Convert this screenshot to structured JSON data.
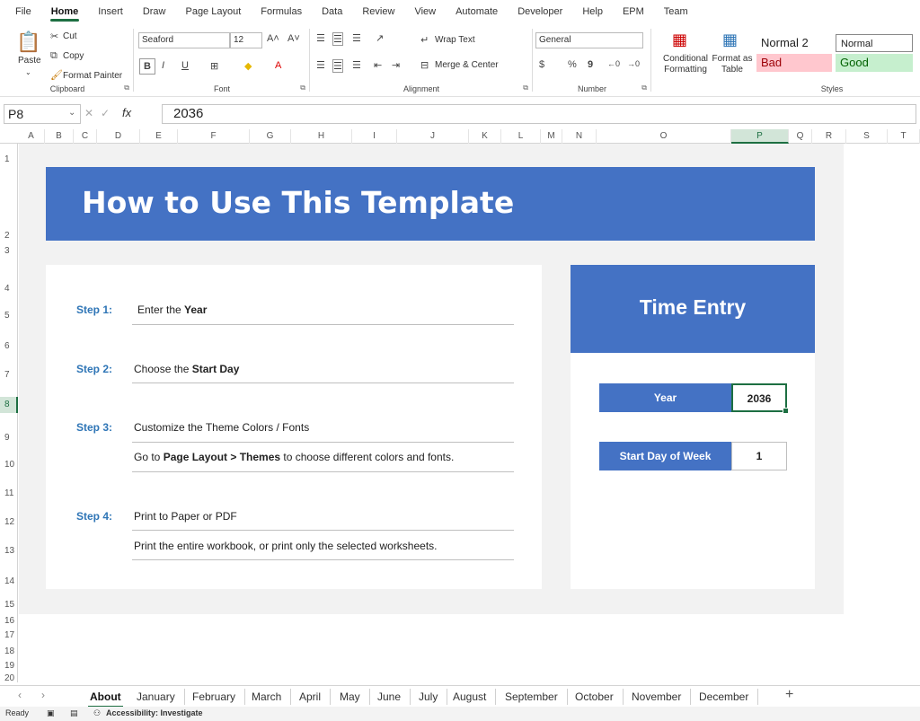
{
  "menu": [
    "File",
    "Home",
    "Insert",
    "Draw",
    "Page Layout",
    "Formulas",
    "Data",
    "Review",
    "View",
    "Automate",
    "Developer",
    "Help",
    "EPM",
    "Team"
  ],
  "ribbon": {
    "clipboard": {
      "paste": "Paste",
      "cut": "Cut",
      "copy": "Copy",
      "format_painter": "Format Painter",
      "label": "Clipboard"
    },
    "font": {
      "name": "Seaford",
      "size": "12",
      "label": "Font",
      "bold": "B",
      "italic": "I",
      "underline": "U"
    },
    "alignment": {
      "wrap": "Wrap Text",
      "merge": "Merge & Center",
      "label": "Alignment"
    },
    "number": {
      "format": "General",
      "label": "Number",
      "currency": "$",
      "percent": "%",
      "comma": "9"
    },
    "styles": {
      "cond_format": "Conditional Formatting",
      "format_table": "Format as Table",
      "normal2": "Normal 2",
      "normal": "Normal",
      "bad": "Bad",
      "good": "Good",
      "label": "Styles"
    }
  },
  "formula_bar": {
    "cell_ref": "P8",
    "fx": "fx",
    "value": "2036"
  },
  "columns": [
    "A",
    "B",
    "C",
    "D",
    "E",
    "F",
    "G",
    "H",
    "I",
    "J",
    "K",
    "L",
    "M",
    "N",
    "O",
    "P",
    "Q",
    "R",
    "S",
    "T"
  ],
  "rows": [
    "1",
    "2",
    "3",
    "4",
    "5",
    "6",
    "7",
    "8",
    "9",
    "10",
    "11",
    "12",
    "13",
    "14",
    "15",
    "16",
    "17",
    "18",
    "19",
    "20"
  ],
  "sheet": {
    "title": "How to Use This Template",
    "steps": [
      {
        "label": "Step 1:",
        "text_pre": "Enter the ",
        "text_bold": "Year",
        "text_post": "",
        "sub": ""
      },
      {
        "label": "Step 2:",
        "text_pre": "Choose the ",
        "text_bold": "Start Day",
        "text_post": "",
        "sub": ""
      },
      {
        "label": "Step 3:",
        "text_pre": "Customize the Theme Colors / Fonts",
        "text_bold": "",
        "text_post": "",
        "sub_pre": "Go to ",
        "sub_bold": "Page Layout > Themes",
        "sub_post": " to choose different colors and fonts."
      },
      {
        "label": "Step 4:",
        "text_pre": "Print to Paper or PDF",
        "text_bold": "",
        "text_post": "",
        "sub": "Print the entire workbook, or print only the selected worksheets."
      }
    ],
    "time_entry": {
      "title": "Time Entry",
      "year_label": "Year",
      "year_value": "2036",
      "start_day_label": "Start Day of Week",
      "start_day_value": "1"
    }
  },
  "tabs": [
    "About",
    "January",
    "February",
    "March",
    "April",
    "May",
    "June",
    "July",
    "August",
    "September",
    "October",
    "November",
    "December"
  ],
  "status": {
    "ready": "Ready",
    "accessibility": "Accessibility: Investigate"
  },
  "colors": {
    "accent": "#4472c4",
    "excel_green": "#1d6f42",
    "step_blue": "#2e75b6"
  }
}
